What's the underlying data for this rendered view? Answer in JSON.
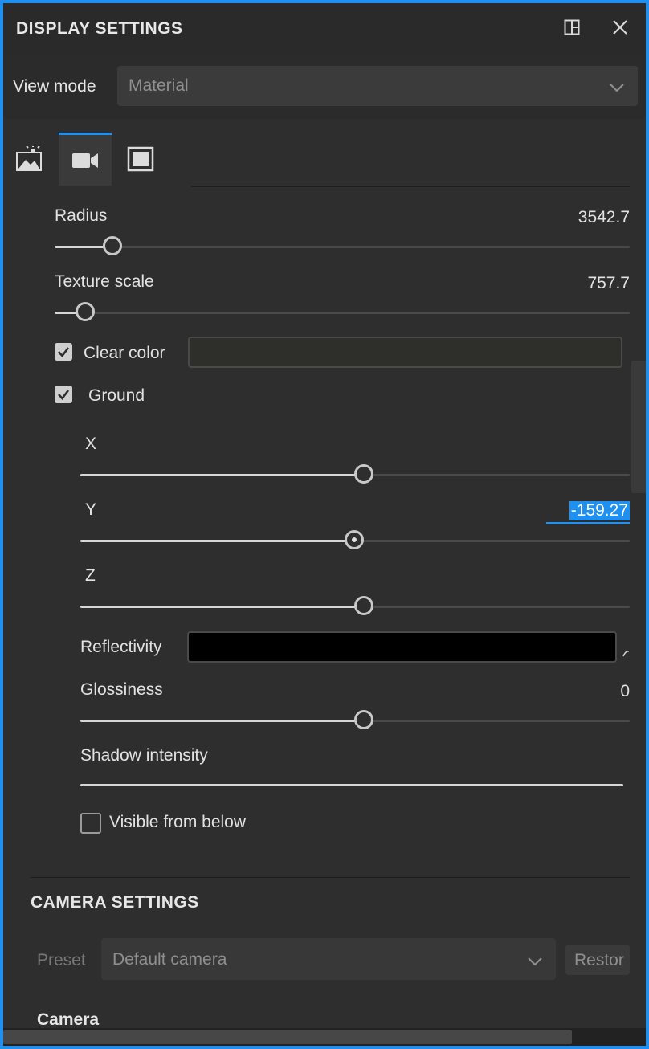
{
  "panel": {
    "title": "DISPLAY SETTINGS",
    "layout_icon": "layout-split-icon",
    "close_icon": "close-icon"
  },
  "view_mode": {
    "label": "View mode",
    "value": "Material"
  },
  "tabs": [
    {
      "name": "environment",
      "icon": "image-sun-icon",
      "active": false
    },
    {
      "name": "camera",
      "icon": "video-camera-icon",
      "active": true
    },
    {
      "name": "frame",
      "icon": "frame-icon",
      "active": false
    }
  ],
  "environment": {
    "radius": {
      "label": "Radius",
      "value": "3542.7",
      "fraction": 0.1
    },
    "texture_scale": {
      "label": "Texture scale",
      "value": "757.7",
      "fraction": 0.05
    },
    "clear_color": {
      "label": "Clear color",
      "checked": true,
      "color": "#2e2e2b"
    },
    "ground": {
      "label": "Ground",
      "checked": true,
      "x": {
        "label": "X",
        "fraction": 0.52
      },
      "y": {
        "label": "Y",
        "value": "-159.27",
        "fraction": 0.5
      },
      "z": {
        "label": "Z",
        "fraction": 0.52
      },
      "reflectivity": {
        "label": "Reflectivity",
        "color": "#000000"
      },
      "glossiness": {
        "label": "Glossiness",
        "value": "0",
        "fraction": 0.52
      },
      "shadow_intensity": {
        "label": "Shadow intensity",
        "fraction": 1.0
      },
      "visible_from_below": {
        "label": "Visible from below",
        "checked": false
      }
    }
  },
  "camera_settings": {
    "title": "CAMERA SETTINGS",
    "preset_label": "Preset",
    "preset_value": "Default camera",
    "restore_label": "Restor",
    "camera_heading": "Camera"
  },
  "colors": {
    "accent": "#1f8ff0",
    "background": "#2e2e2e"
  }
}
